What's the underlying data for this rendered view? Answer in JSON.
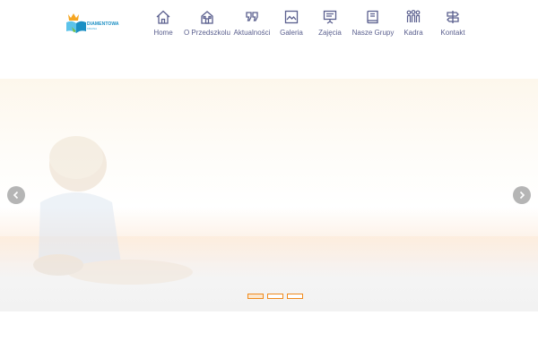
{
  "brand": {
    "name": "DIAMENTOWA",
    "sub": "KRAINA",
    "icon": "book-crown-logo",
    "colors": {
      "blue": "#1b8fc4",
      "light_blue": "#5cc3ea",
      "orange": "#f5a623",
      "green": "#7ac143"
    }
  },
  "nav": {
    "items": [
      {
        "label": "Home",
        "icon": "home-icon"
      },
      {
        "label": "O Przedszkolu",
        "icon": "building-icon"
      },
      {
        "label": "Aktualności",
        "icon": "quote-icon"
      },
      {
        "label": "Galeria",
        "icon": "image-icon"
      },
      {
        "label": "Zajęcia",
        "icon": "presentation-board-icon"
      },
      {
        "label": "Nasze Grupy",
        "icon": "book-icon"
      },
      {
        "label": "Kadra",
        "icon": "people-icon"
      },
      {
        "label": "Kontakt",
        "icon": "signpost-icon"
      }
    ],
    "text_color": "#5a5f8e"
  },
  "slider": {
    "slides_count": 3,
    "active_index": 0,
    "accent": "#f08a1c",
    "arrow_color": "#b5b5b5",
    "arrows": {
      "prev": "chevron-left-icon",
      "next": "chevron-right-icon"
    }
  }
}
